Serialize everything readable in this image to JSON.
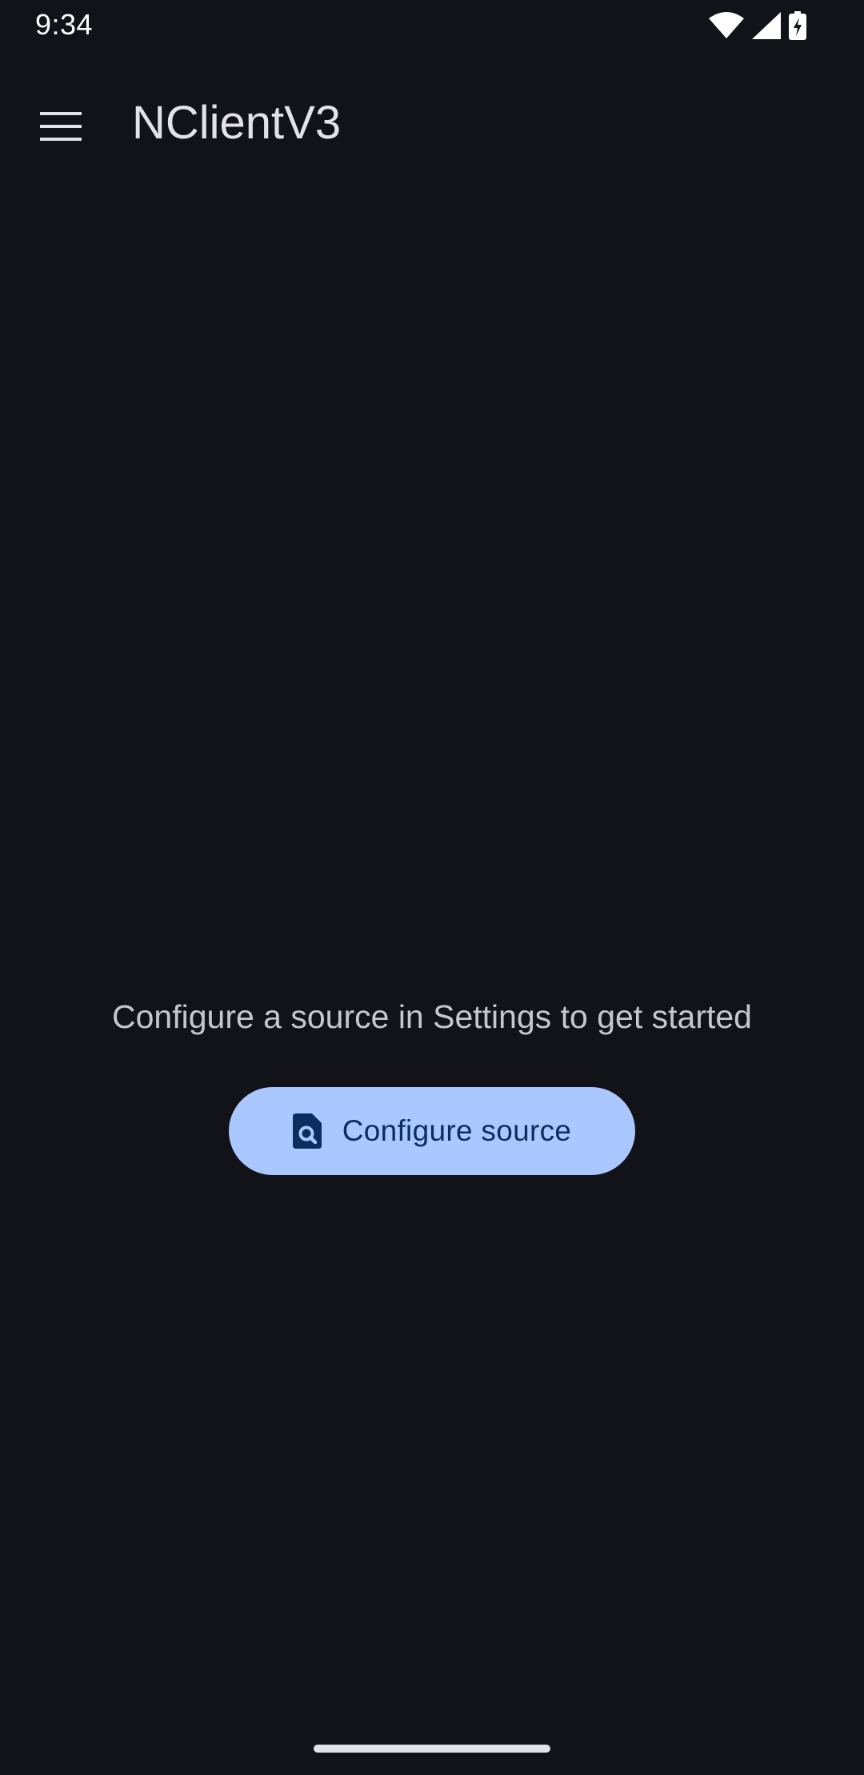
{
  "status_bar": {
    "time": "9:34",
    "icons": [
      "wifi-icon",
      "cellular-signal-icon",
      "battery-charging-icon"
    ]
  },
  "app_bar": {
    "menu_icon": "hamburger-menu-icon",
    "title": "NClientV3"
  },
  "empty_state": {
    "message": "Configure a source in Settings to get started",
    "button": {
      "icon": "document-search-icon",
      "label": "Configure source"
    }
  },
  "colors": {
    "background": "#121318",
    "button_fill": "#aac7ff",
    "button_text": "#0b2e5e",
    "primary_text": "#e3e2e9",
    "secondary_text": "#c6c6d0"
  }
}
